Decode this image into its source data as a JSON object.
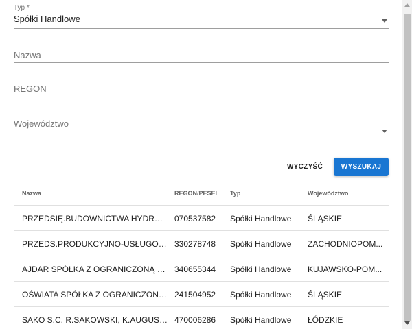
{
  "form": {
    "type_label": "Typ *",
    "type_value": "Spółki Handlowe",
    "name_placeholder": "Nazwa",
    "regon_placeholder": "REGON",
    "province_placeholder": "Województwo"
  },
  "actions": {
    "clear_label": "WYCZYŚĆ",
    "search_label": "WYSZUKAJ"
  },
  "table": {
    "headers": [
      "Nazwa",
      "REGON/PESEL",
      "Typ",
      "Województwo"
    ],
    "rows": [
      {
        "name": "PRZEDSIĘ.BUDOWNICTWA HYDROTE...",
        "regon": "070537582",
        "type": "Spółki Handlowe",
        "province": "ŚLĄSKIE"
      },
      {
        "name": "PRZEDS.PRODUKCYJNO-USŁUGOWO-...",
        "regon": "330278748",
        "type": "Spółki Handlowe",
        "province": "ZACHODNIOPOM..."
      },
      {
        "name": "AJDAR SPÓŁKA Z OGRANICZONĄ OD...",
        "regon": "340655344",
        "type": "Spółki Handlowe",
        "province": "KUJAWSKO-POM..."
      },
      {
        "name": "OŚWIATA SPÓŁKA Z OGRANICZONĄ ...",
        "regon": "241504952",
        "type": "Spółki Handlowe",
        "province": "ŚLĄSKIE"
      },
      {
        "name": "SAKO S.C. R.SAKOWSKI, K.AUGUSTYN...",
        "regon": "470006286",
        "type": "Spółki Handlowe",
        "province": "ŁÓDZKIE"
      }
    ]
  },
  "colors": {
    "primary": "#1976d2",
    "divider": "#e0e0e0",
    "field_underline": "#9e9e9e"
  },
  "icons": {
    "select_caret": "caret-down-icon",
    "scroll_up": "scroll-up-arrow-icon",
    "scroll_down": "scroll-down-arrow-icon"
  }
}
